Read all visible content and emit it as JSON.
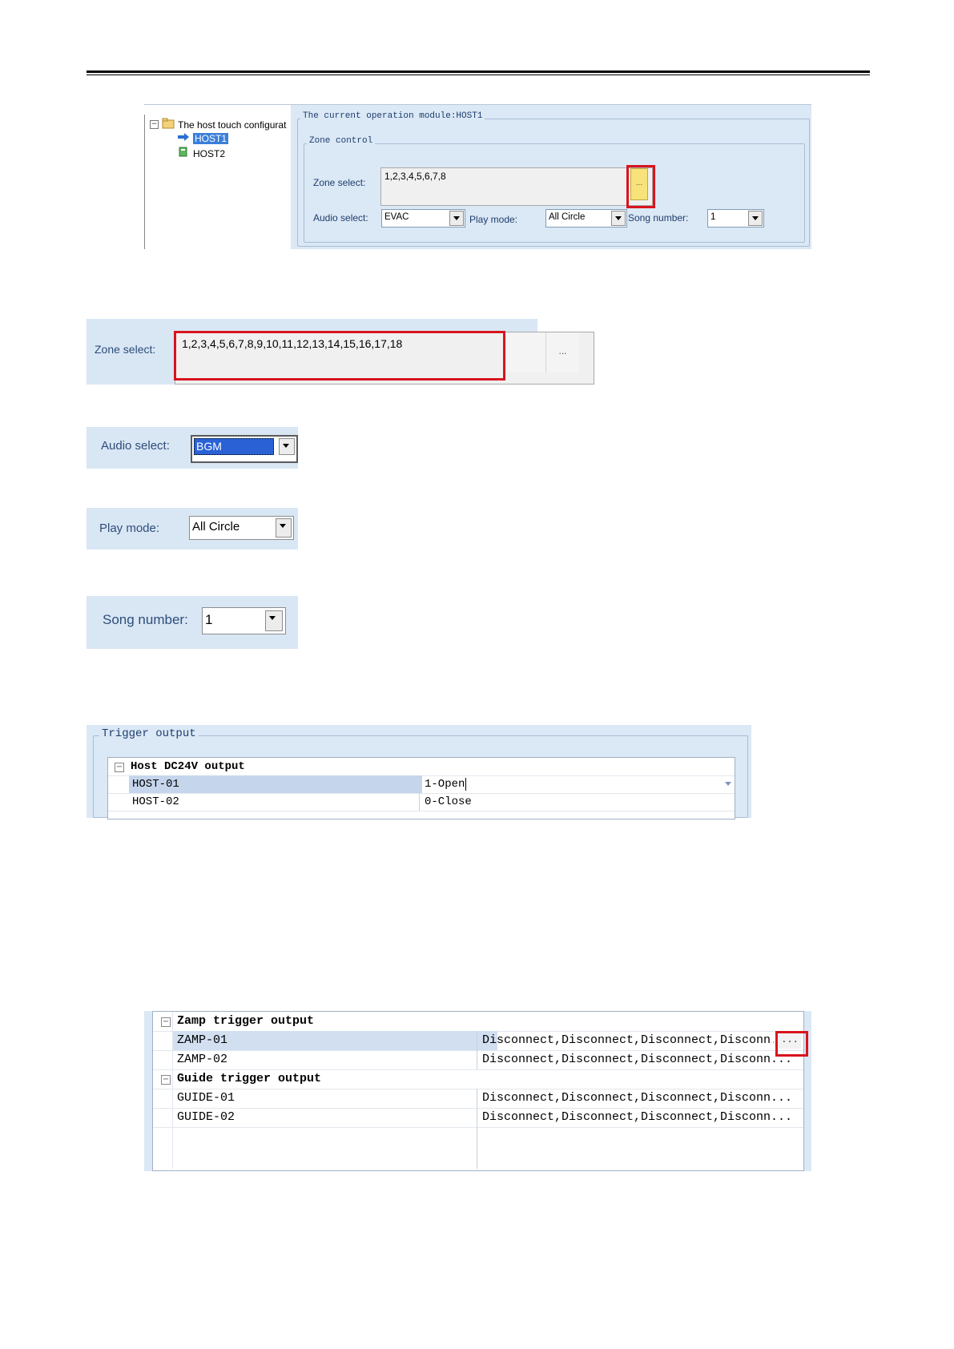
{
  "panel1": {
    "tree": {
      "root": "The host touch configurat",
      "nodes": [
        "HOST1",
        "HOST2"
      ]
    },
    "operation_module": "The current operation module:HOST1",
    "zone_group_title": "Zone control",
    "zone_select_label": "Zone select:",
    "zone_select_value": "1,2,3,4,5,6,7,8",
    "zone_button": "...",
    "audio_select_label": "Audio select:",
    "audio_select_value": "EVAC",
    "play_mode_label": "Play mode:",
    "play_mode_value": "All Circle",
    "song_number_label": "Song number:",
    "song_number_value": "1"
  },
  "zone_panel": {
    "label": "Zone select:",
    "value": "1,2,3,4,5,6,7,8,9,10,11,12,13,14,15,16,17,18",
    "button": "..."
  },
  "audio_panel": {
    "label": "Audio select:",
    "value": "BGM"
  },
  "play_panel": {
    "label": "Play mode:",
    "value": "All Circle"
  },
  "song_panel": {
    "label": "Song number:",
    "value": "1"
  },
  "trigger_panel": {
    "title": "Trigger output",
    "group": "Host DC24V output",
    "rows": [
      {
        "name": "HOST-01",
        "value": "1-Open"
      },
      {
        "name": "HOST-02",
        "value": "0-Close"
      }
    ]
  },
  "zamp_panel": {
    "groups": [
      {
        "title": "Zamp trigger output",
        "rows": [
          {
            "name": "ZAMP-01",
            "value": "Disconnect,Disconnect,Disconnect,Disconn..."
          },
          {
            "name": "ZAMP-02",
            "value": "Disconnect,Disconnect,Disconnect,Disconn..."
          }
        ]
      },
      {
        "title": "Guide trigger output",
        "rows": [
          {
            "name": "GUIDE-01",
            "value": "Disconnect,Disconnect,Disconnect,Disconn..."
          },
          {
            "name": "GUIDE-02",
            "value": "Disconnect,Disconnect,Disconnect,Disconn..."
          }
        ]
      }
    ],
    "button": "..."
  },
  "colors": {
    "panel_bg": "#dbe8f5",
    "highlight": "#d8141e",
    "selection": "#3a7fd9"
  }
}
